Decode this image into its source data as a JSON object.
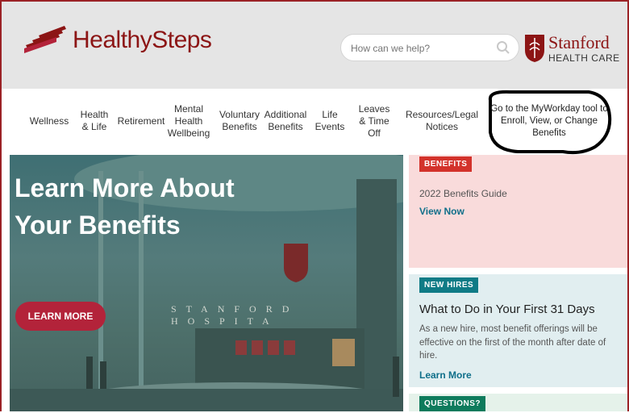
{
  "header": {
    "brand": "HealthySteps",
    "search_placeholder": "How can we help?",
    "partner_name": "Stanford",
    "partner_sub": "HEALTH CARE"
  },
  "nav": {
    "items": [
      {
        "id": "wellness",
        "label": "Wellness"
      },
      {
        "id": "health-life",
        "label": "Health & Life"
      },
      {
        "id": "retirement",
        "label": "Retirement"
      },
      {
        "id": "mental-health",
        "label": "Mental Health Wellbeing"
      },
      {
        "id": "voluntary",
        "label": "Voluntary Benefits"
      },
      {
        "id": "additional",
        "label": "Additional Benefits"
      },
      {
        "id": "life-events",
        "label": "Life Events"
      },
      {
        "id": "leaves",
        "label": "Leaves & Time Off"
      },
      {
        "id": "resources",
        "label": "Resources/Legal Notices"
      }
    ],
    "myworkday": "Go to the MyWorkday tool to Enroll, View, or Change Benefits"
  },
  "hero": {
    "title_line1": "Learn More About",
    "title_line2": "Your Benefits",
    "button": "LEARN MORE",
    "building_text": "STANFORD HOSPITA"
  },
  "cards": {
    "benefits": {
      "badge": "BENEFITS",
      "subtitle": "2022 Benefits Guide",
      "link": "View Now"
    },
    "new_hires": {
      "badge": "NEW HIRES",
      "title": "What to Do in Your First 31 Days",
      "body": "As a new hire, most benefit offerings will be effective on the first of the month after date of hire.",
      "link": "Learn More"
    },
    "questions": {
      "badge": "QUESTIONS?"
    }
  },
  "colors": {
    "brand_red": "#8c1515",
    "button_red": "#b3233a",
    "badge_red": "#d3322b",
    "badge_teal": "#0f7b86",
    "badge_green": "#0e7b5c",
    "link": "#0f6f8a"
  },
  "icons": {
    "logo": "healthysteps-steps-icon",
    "search": "search-icon",
    "partner": "stanford-shield-icon"
  }
}
